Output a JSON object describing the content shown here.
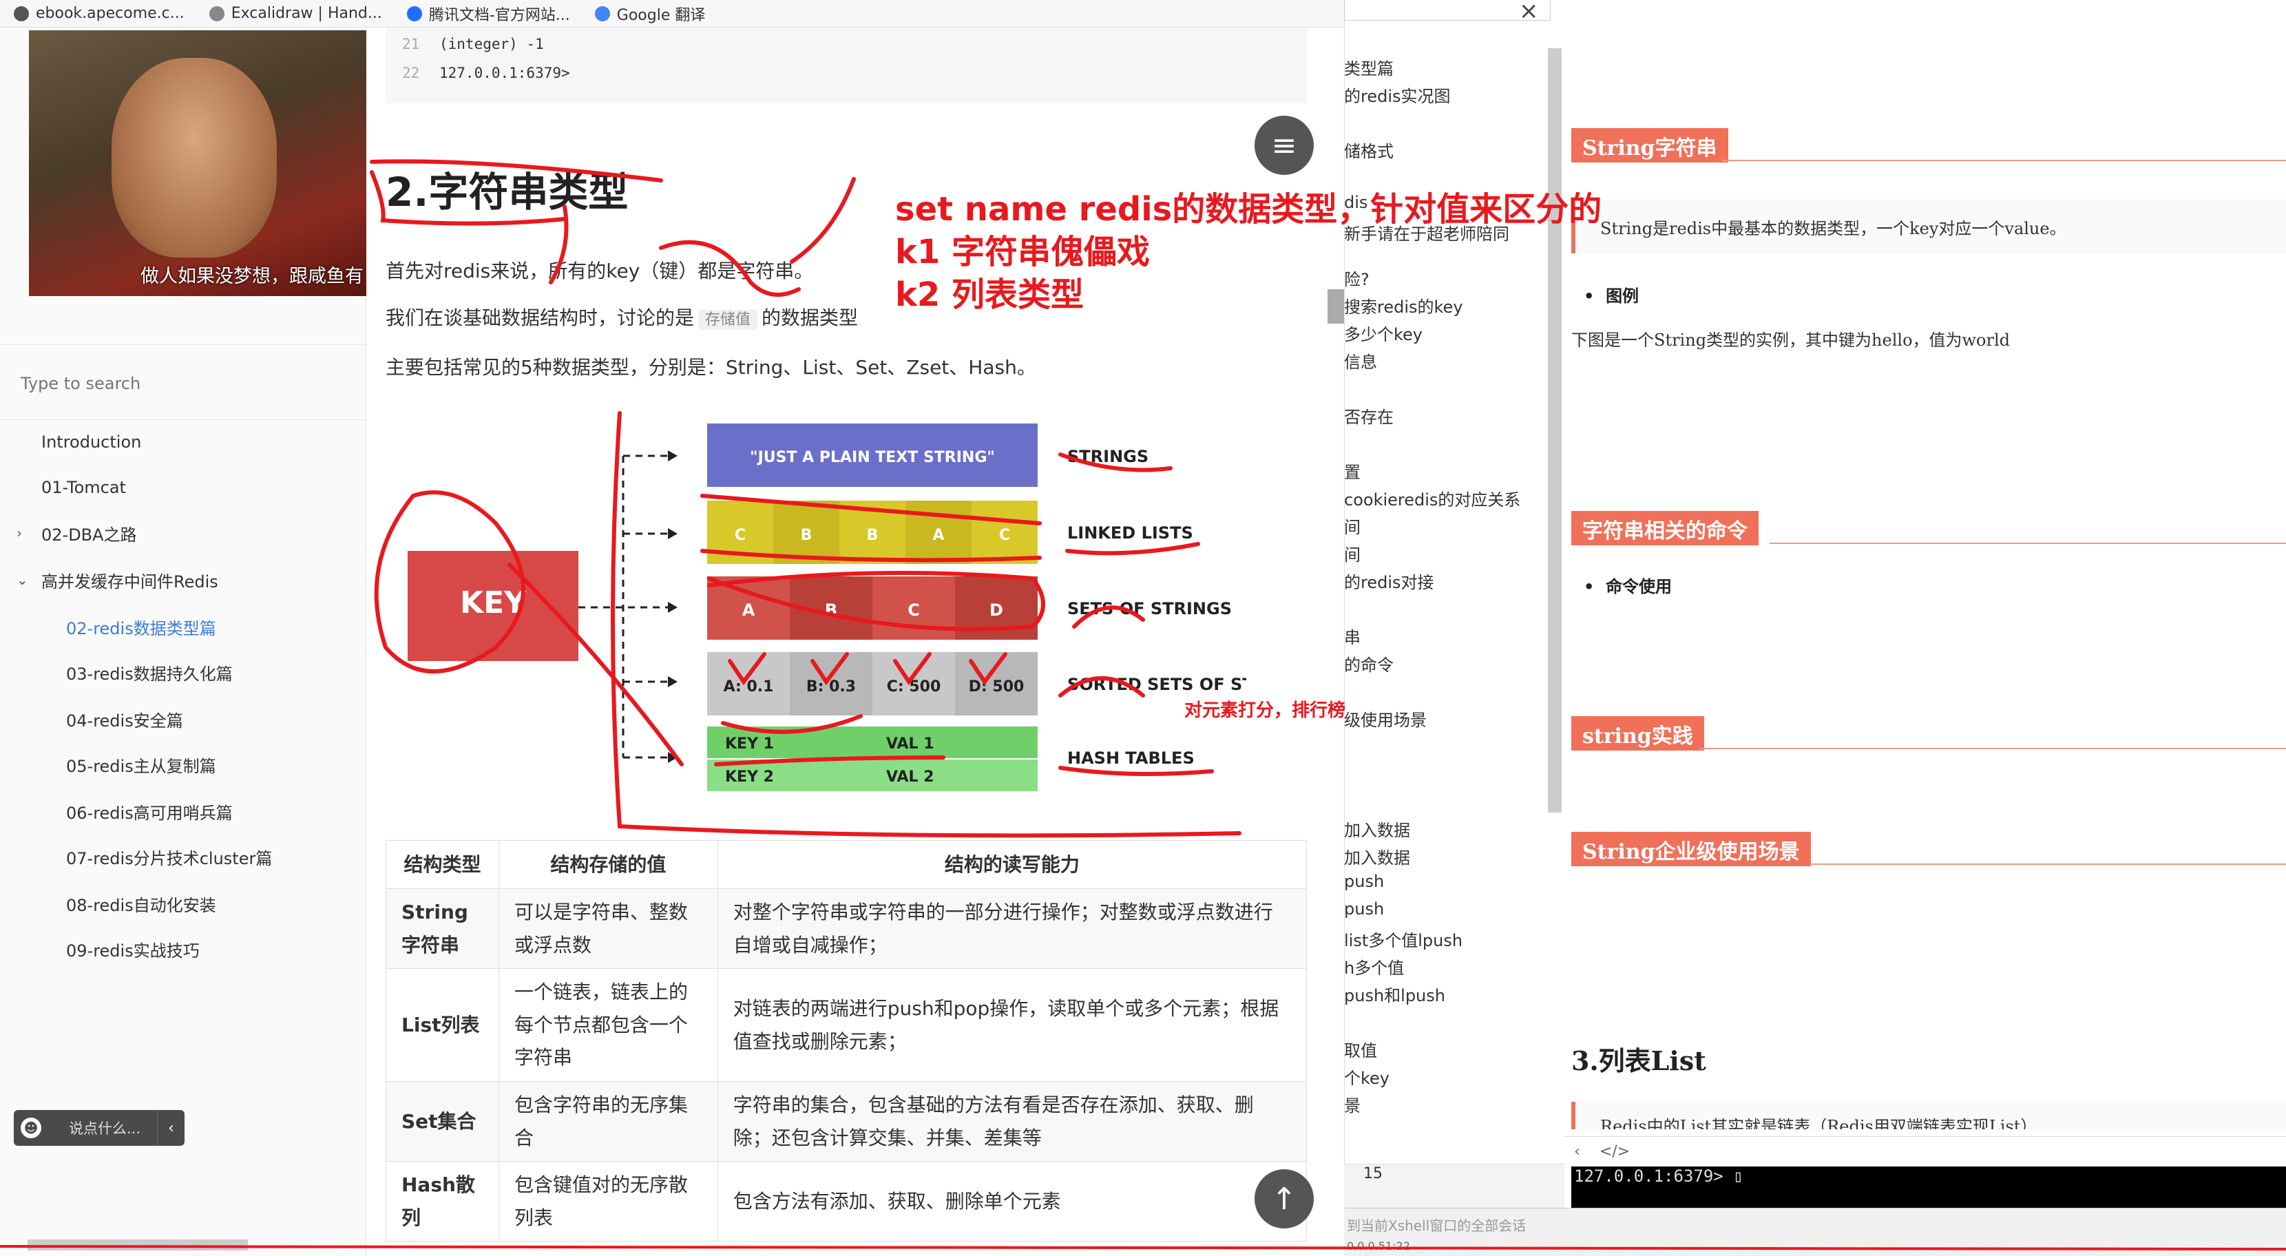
{
  "bookmarks": [
    {
      "label": "ebook.apecome.c...",
      "icon": "globe-icon",
      "color": "#555555"
    },
    {
      "label": "Excalidraw | Hand...",
      "icon": "pencil-icon",
      "color": "#888888"
    },
    {
      "label": "腾讯文档-官方网站...",
      "icon": "tencent-docs-icon",
      "color": "#1e6fff"
    },
    {
      "label": "Google 翻译",
      "icon": "google-translate-icon",
      "color": "#4285f4"
    }
  ],
  "sidebar": {
    "avatar_caption": "做人如果没梦想，跟咸鱼有",
    "search_placeholder": "Type to search",
    "items": [
      {
        "label": "Introduction",
        "level": 0
      },
      {
        "label": "01-Tomcat",
        "level": 0
      },
      {
        "label": "02-DBA之路",
        "level": 0,
        "chevron": "›"
      },
      {
        "label": "高并发缓存中间件Redis",
        "level": 0,
        "chevron": "⌄"
      },
      {
        "label": "02-redis数据类型篇",
        "level": 1,
        "active": true
      },
      {
        "label": "03-redis数据持久化篇",
        "level": 1
      },
      {
        "label": "04-redis安全篇",
        "level": 1
      },
      {
        "label": "05-redis主从复制篇",
        "level": 1
      },
      {
        "label": "06-redis高可用哨兵篇",
        "level": 1
      },
      {
        "label": "07-redis分片技术cluster篇",
        "level": 1
      },
      {
        "label": "08-redis自动化安装",
        "level": 1
      },
      {
        "label": "09-redis实战技巧",
        "level": 1
      }
    ],
    "chat_label": "说点什么...",
    "chat_arrow": "‹",
    "smile": "☻"
  },
  "main": {
    "code_lines": [
      {
        "n": "21",
        "text": "(integer) -1"
      },
      {
        "n": "22",
        "text": "127.0.0.1:6379>"
      }
    ],
    "heading": "2.字符串类型",
    "p1": "首先对redis来说，所有的key（键）都是字符串。",
    "p2_before": "我们在谈基础数据结构时，讨论的是",
    "p2_tag": "存储值",
    "p2_after": "的数据类型",
    "p3": "主要包括常见的5种数据类型，分别是：String、List、Set、Zset、Hash。",
    "menu_glyph": "≡",
    "top_glyph": "↑",
    "diagram": {
      "key": "KEY",
      "strings_value": "\"JUST A PLAIN TEXT STRING\"",
      "strings_label": "STRINGS",
      "list_cells": [
        "C",
        "B",
        "B",
        "A",
        "C"
      ],
      "list_label": "LINKED LISTS",
      "set_cells": [
        "A",
        "B",
        "C",
        "D"
      ],
      "set_label": "SETS OF STRINGS",
      "zset_cells": [
        "A: 0.1",
        "B: 0.3",
        "C: 500",
        "D: 500"
      ],
      "zset_label": "SORTED SETS OF STRINGS",
      "hash_rows": [
        [
          "KEY 1",
          "VAL 1"
        ],
        [
          "KEY 2",
          "VAL 2"
        ]
      ],
      "hash_label": "HASH TABLES",
      "colors": {
        "strings": "#6a6fc9",
        "list": "#d9c82a",
        "set": "#d1524a",
        "zset": "#c8c8c8",
        "hash": "#6fd06a",
        "key": "#d94848"
      }
    },
    "table": {
      "headers": [
        "结构类型",
        "结构存储的值",
        "结构的读写能力"
      ],
      "rows": [
        [
          "String字符串",
          "可以是字符串、整数或浮点数",
          "对整个字符串或字符串的一部分进行操作；对整数或浮点数进行自增或自减操作；"
        ],
        [
          "List列表",
          "一个链表，链表上的每个节点都包含一个字符串",
          "对链表的两端进行push和pop操作，读取单个或多个元素；根据值查找或删除元素；"
        ],
        [
          "Set集合",
          "包含字符串的无序集合",
          "字符串的集合，包含基础的方法有看是否存在添加、获取、删除；还包含计算交集、并集、差集等"
        ],
        [
          "Hash散列",
          "包含键值对的无序散列表",
          "包含方法有添加、获取、删除单个元素"
        ]
      ]
    }
  },
  "annotations": {
    "line1": "set  name   redis的数据类型，针对值来区分的",
    "line2": "k1   字符串傀儡戏",
    "line3": "k2   列表类型",
    "zset_note": "对元素打分，排行榜",
    "color": "#e8191e"
  },
  "middle": {
    "close": "×",
    "items": [
      "类型篇",
      "的redis实况图",
      "储格式",
      "dis",
      "新手请在于超老师陪同",
      "险?",
      "搜索redis的key",
      "多少个key",
      "信息",
      "",
      "否存在",
      "置",
      "cookieredis的对应关系",
      "间",
      "间",
      "的redis对接",
      "串",
      "的命令",
      "级使用场景",
      "加入数据",
      "加入数据",
      "push",
      "push",
      "list多个值lpush",
      "h多个值",
      "push和lpush",
      "",
      "取值",
      "个key",
      "景"
    ],
    "bottom_num": "15",
    "bottom_text": "到当前Xshell窗口的全部会话",
    "bottom_ip": "0.0.0.51:22"
  },
  "right": {
    "s1": "String字符串",
    "quote": "String是redis中最基本的数据类型，一个key对应一个value。",
    "b1": "图例",
    "t1": "下图是一个String类型的实例，其中键为hello，值为world",
    "s2": "字符串相关的命令",
    "b2": "命令使用",
    "s3": "string实践",
    "s4": "String企业级使用场景",
    "h3": "3.列表List",
    "quote2": "Redis中的List其实就是链表（Redis用双端链表实现List）",
    "tool_left": "‹",
    "tool_code": "</>",
    "terminal": "127.0.0.1:6379> ▯"
  }
}
